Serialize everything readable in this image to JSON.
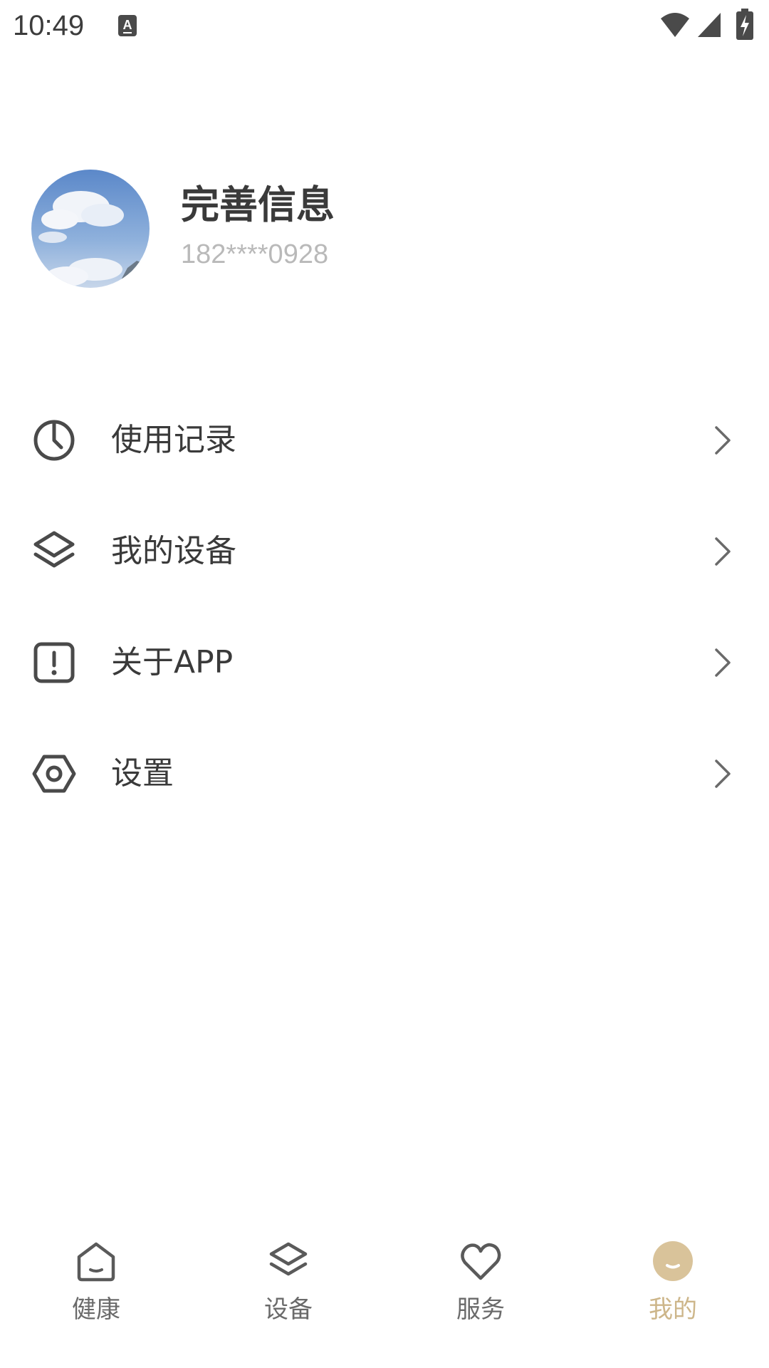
{
  "status_bar": {
    "time": "10:49",
    "icons": [
      "keyboard-a-icon",
      "wifi-icon",
      "cell-signal-icon",
      "battery-charging-icon"
    ]
  },
  "profile": {
    "name": "完善信息",
    "phone": "182****0928",
    "avatar": "sky-clouds-avatar"
  },
  "menu": {
    "items": [
      {
        "label": "使用记录",
        "icon": "clock-icon"
      },
      {
        "label": "我的设备",
        "icon": "layers-icon"
      },
      {
        "label": "关于APP",
        "icon": "info-exclamation-icon"
      },
      {
        "label": "设置",
        "icon": "settings-hexagon-icon"
      }
    ]
  },
  "bottom_nav": {
    "items": [
      {
        "label": "健康",
        "icon": "home-icon",
        "active": false
      },
      {
        "label": "设备",
        "icon": "layers-icon",
        "active": false
      },
      {
        "label": "服务",
        "icon": "heart-icon",
        "active": false
      },
      {
        "label": "我的",
        "icon": "profile-face-icon",
        "active": true
      }
    ]
  },
  "colors": {
    "text_primary": "#3a3a3a",
    "text_secondary": "#b9b9b9",
    "nav_inactive": "#6a6a6a",
    "accent": "#cdb68a",
    "background": "#ffffff"
  }
}
